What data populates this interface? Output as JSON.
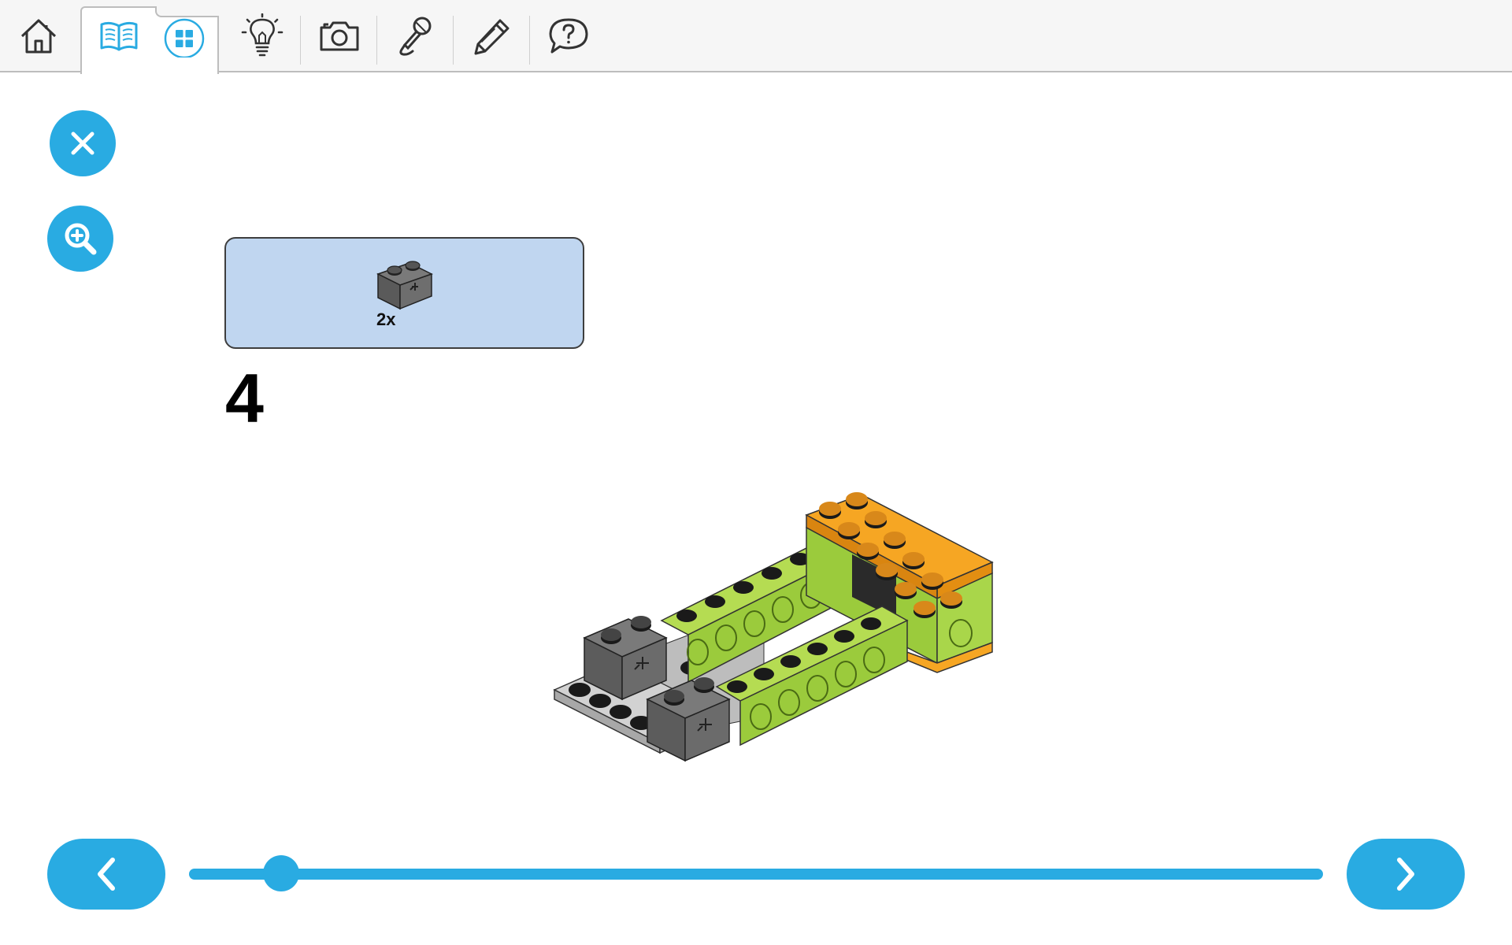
{
  "toolbar": {
    "icons": [
      "home-icon",
      "open-book-icon",
      "grid-icon",
      "lightbulb-icon",
      "camera-icon",
      "microphone-icon",
      "pencil-icon",
      "question-bubble-icon"
    ],
    "active_tab": "building-instructions",
    "accent_color": "#29abe2",
    "icon_color": "#333333"
  },
  "side_buttons": {
    "icons": [
      "close-icon",
      "zoom-in-icon"
    ],
    "color": "#29abe2"
  },
  "parts_callout": {
    "quantity": "2x",
    "background": "#c0d6f0"
  },
  "step": {
    "number": "4"
  },
  "model_colors": {
    "lime": "#9bcb3c",
    "orange": "#f6a623",
    "dark_gray": "#6b6b6b",
    "light_gray": "#c8c8c8"
  },
  "navigation": {
    "icons": [
      "chevron-left-icon",
      "chevron-right-icon"
    ],
    "progress": 0.081
  }
}
